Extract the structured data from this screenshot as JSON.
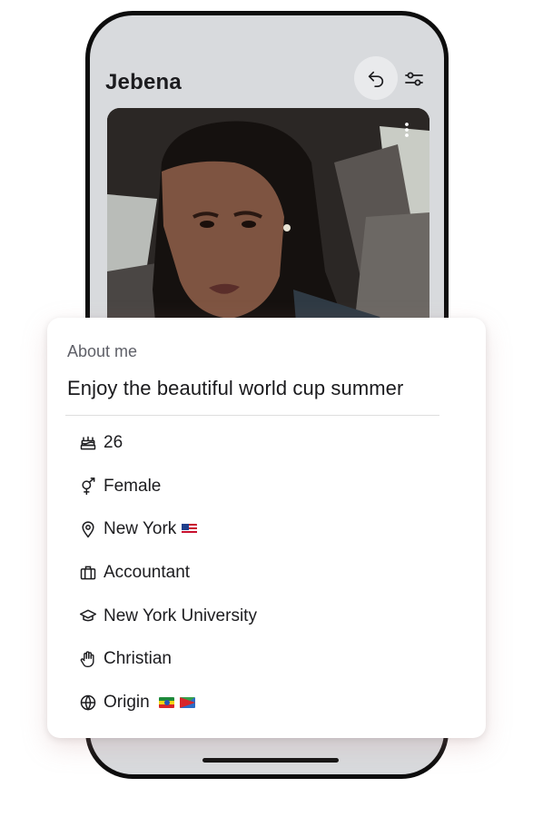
{
  "header": {
    "title": "Jebena"
  },
  "icons": {
    "undo": "undo-icon",
    "filter": "sliders-icon",
    "more": "more-vertical-icon"
  },
  "about": {
    "heading": "About me",
    "headline": "Enjoy the beautiful world cup summer",
    "details": [
      {
        "icon": "cake-icon",
        "text": "26"
      },
      {
        "icon": "gender-icon",
        "text": "Female"
      },
      {
        "icon": "location-pin-icon",
        "text": "New York",
        "flags": [
          "us"
        ]
      },
      {
        "icon": "briefcase-icon",
        "text": "Accountant"
      },
      {
        "icon": "graduation-cap-icon",
        "text": "New York University"
      },
      {
        "icon": "hand-icon",
        "text": "Christian"
      },
      {
        "icon": "globe-icon",
        "text": "Origin",
        "flags": [
          "et",
          "er"
        ]
      }
    ]
  },
  "colors": {
    "phone_bg": "#d8dadd",
    "frame": "#0d0d0d",
    "card_bg": "#ffffff",
    "muted_text": "#5f6068"
  }
}
